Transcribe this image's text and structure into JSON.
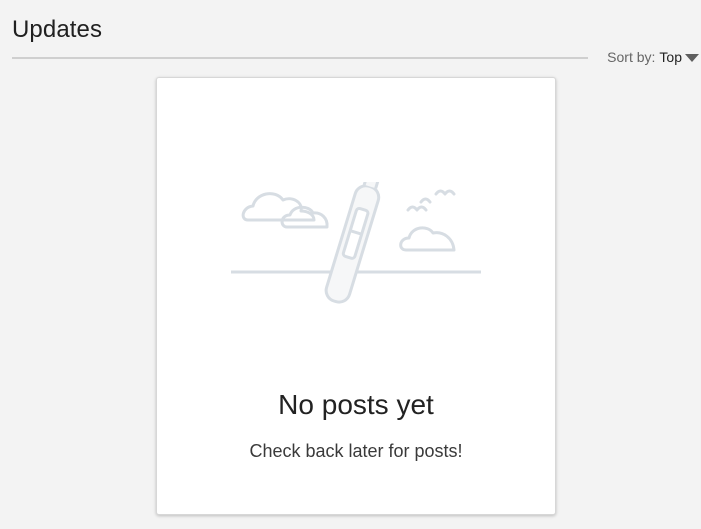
{
  "header": {
    "title": "Updates"
  },
  "sort": {
    "label": "Sort by:",
    "value": "Top",
    "caret_icon": "triangle-down-icon"
  },
  "empty_state": {
    "illustration_icon": "message-in-bottle-illustration",
    "heading": "No posts yet",
    "subtext": "Check back later for posts!"
  },
  "colors": {
    "page_background": "#f3f3f3",
    "card_background": "#ffffff",
    "divider": "#cfcfcf",
    "illustration_stroke": "#d7dde3"
  }
}
